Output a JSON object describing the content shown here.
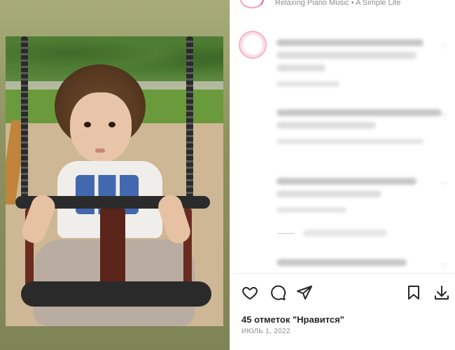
{
  "header": {
    "audio_text": "Relaxing Piano Music • A Simple Life"
  },
  "comments": [
    {
      "author_blurred": "",
      "text_blurred": "",
      "meta_blurred": ""
    },
    {
      "author_blurred": "",
      "text_blurred": "",
      "meta_blurred": ""
    },
    {
      "author_blurred": "",
      "text_blurred": "",
      "meta_blurred": ""
    },
    {
      "author_blurred": "",
      "text_blurred": "",
      "meta_blurred": ""
    }
  ],
  "actions": {
    "like_icon": "heart-icon",
    "comment_icon": "comment-icon",
    "share_icon": "send-icon",
    "save_icon": "bookmark-icon",
    "download_icon": "download-icon"
  },
  "likes": "45 отметок \"Нравится\"",
  "date": "ИЮЛЬ 1, 2022",
  "colors": {
    "accent_ring": "#f7b2c4",
    "muted_text": "#8e8e8e",
    "primary_text": "#262626"
  }
}
